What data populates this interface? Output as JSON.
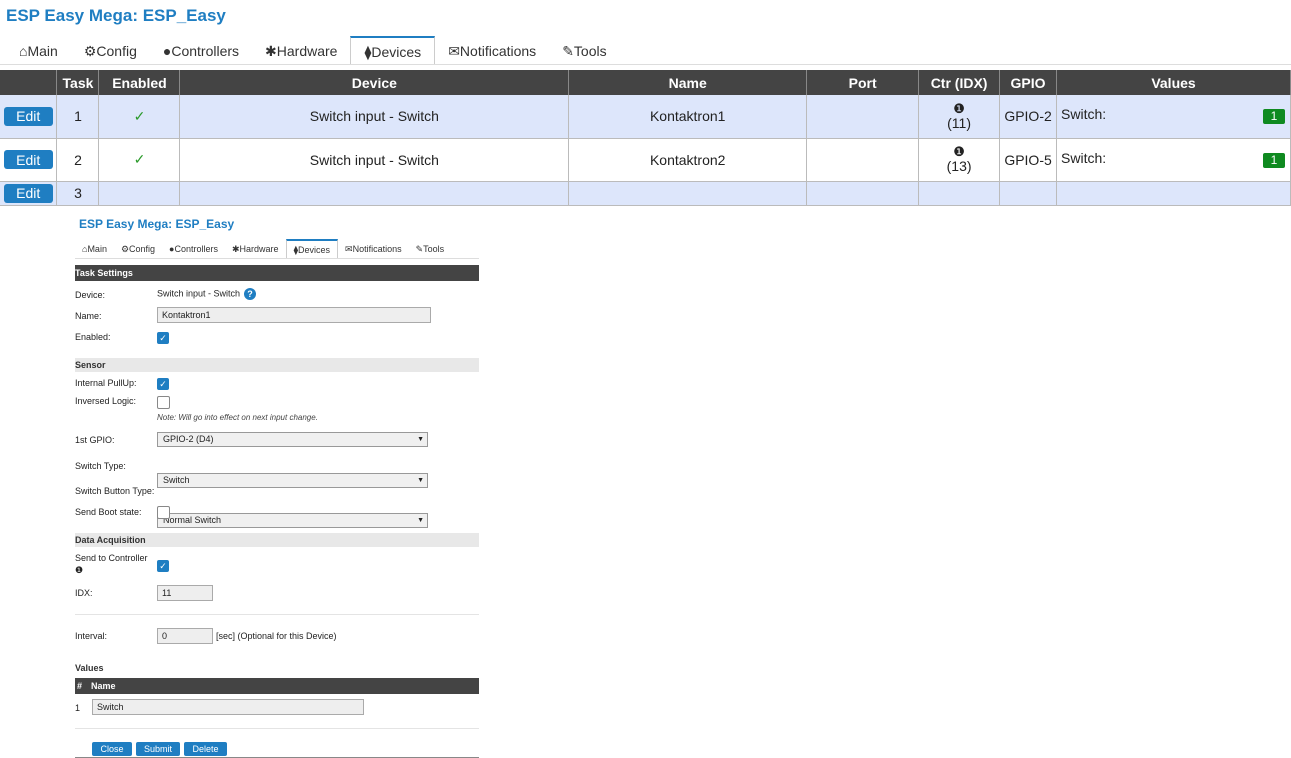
{
  "app": {
    "title": "ESP Easy Mega: ESP_Easy"
  },
  "tabs": [
    {
      "icon": "home-icon",
      "glyph": "⌂",
      "label": "Main"
    },
    {
      "icon": "gear-icon",
      "glyph": "⚙",
      "label": "Config"
    },
    {
      "icon": "comment-icon",
      "glyph": "●",
      "label": "Controllers"
    },
    {
      "icon": "pin-icon",
      "glyph": "✱",
      "label": "Hardware"
    },
    {
      "icon": "plug-icon",
      "glyph": "⧫",
      "label": "Devices"
    },
    {
      "icon": "envelope-icon",
      "glyph": "✉",
      "label": "Notifications"
    },
    {
      "icon": "wrench-icon",
      "glyph": "✎",
      "label": "Tools"
    }
  ],
  "active_tab": "Devices",
  "device_table": {
    "headers": [
      "",
      "Task",
      "Enabled",
      "Device",
      "Name",
      "Port",
      "Ctr (IDX)",
      "GPIO",
      "Values"
    ],
    "edit_label": "Edit",
    "rows": [
      {
        "task": "1",
        "enabled": "✓",
        "device": "Switch input - Switch",
        "name": "Kontaktron1",
        "port": "",
        "ctr_dot": "❶",
        "ctr_idx": "(11)",
        "gpio": "GPIO-2",
        "value_label": "Switch:",
        "value": "1"
      },
      {
        "task": "2",
        "enabled": "✓",
        "device": "Switch input - Switch",
        "name": "Kontaktron2",
        "port": "",
        "ctr_dot": "❶",
        "ctr_idx": "(13)",
        "gpio": "GPIO-5",
        "value_label": "Switch:",
        "value": "1"
      },
      {
        "task": "3",
        "enabled": "",
        "device": "",
        "name": "",
        "port": "",
        "ctr_dot": "",
        "ctr_idx": "",
        "gpio": "",
        "value_label": "",
        "value": ""
      }
    ]
  },
  "panel": {
    "title": "ESP Easy Mega: ESP_Easy",
    "task_settings_header": "Task Settings",
    "device_label": "Device:",
    "device_value": "Switch input - Switch",
    "info_glyph": "?",
    "name_label": "Name:",
    "name_value": "Kontaktron1",
    "enabled_label": "Enabled:",
    "sensor_header": "Sensor",
    "pullup_label": "Internal PullUp:",
    "inversed_label": "Inversed Logic:",
    "note": "Note: Will go into effect on next input change.",
    "gpio_label": "1st GPIO:",
    "gpio_value": "GPIO-2 (D4)",
    "switch_type_label": "Switch Type:",
    "switch_type_value": "Switch",
    "button_type_label": "Switch Button Type:",
    "button_type_value": "Normal Switch",
    "boot_label": "Send Boot state:",
    "data_header": "Data Acquisition",
    "send_ctrl_label": "Send to Controller",
    "send_ctrl_dot": "❶",
    "idx_label": "IDX:",
    "idx_value": "11",
    "interval_label": "Interval:",
    "interval_value": "0",
    "interval_unit": "[sec] (Optional for this Device)",
    "values_header": "Values",
    "values_col_num": "#",
    "values_col_name": "Name",
    "value_row_num": "1",
    "value_row_name": "Switch",
    "close_label": "Close",
    "submit_label": "Submit",
    "delete_label": "Delete"
  },
  "colors": {
    "accent": "#1f7ec2",
    "header_bg": "#444444",
    "row_odd": "#dde6fb",
    "badge": "#0f8a20"
  }
}
